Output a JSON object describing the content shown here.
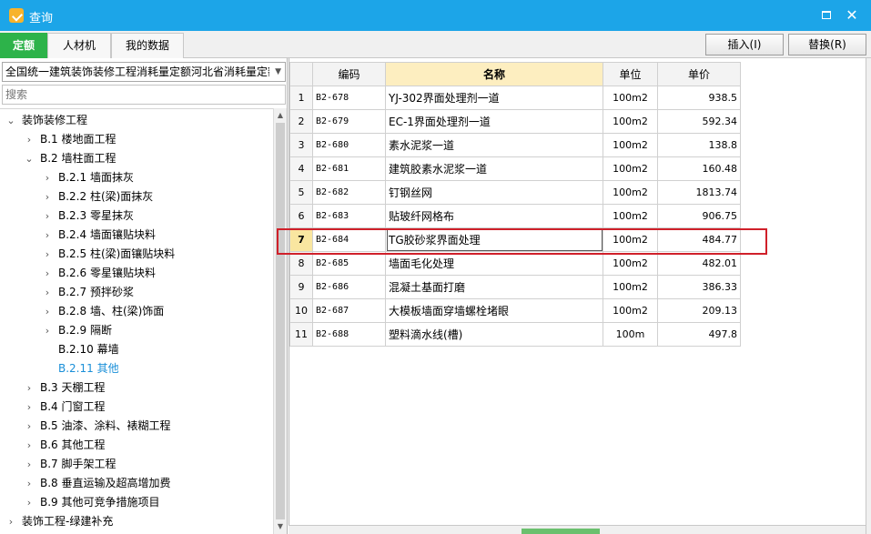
{
  "window": {
    "title": "查询"
  },
  "tabs": [
    {
      "label": "定额",
      "active": true
    },
    {
      "label": "人材机",
      "active": false
    },
    {
      "label": "我的数据",
      "active": false
    }
  ],
  "actions": {
    "insert_label": "插入(I)",
    "replace_label": "替换(R)"
  },
  "library": {
    "selected": "全国统一建筑装饰装修工程消耗量定额河北省消耗量定额"
  },
  "search": {
    "placeholder": "搜索"
  },
  "tree": [
    {
      "label": "装饰装修工程",
      "level": 0,
      "expanded": true
    },
    {
      "label": "B.1 楼地面工程",
      "level": 1,
      "expanded": false
    },
    {
      "label": "B.2 墙柱面工程",
      "level": 1,
      "expanded": true
    },
    {
      "label": "B.2.1 墙面抹灰",
      "level": 2,
      "expanded": false
    },
    {
      "label": "B.2.2 柱(梁)面抹灰",
      "level": 2,
      "expanded": false
    },
    {
      "label": "B.2.3 零星抹灰",
      "level": 2,
      "expanded": false
    },
    {
      "label": "B.2.4 墙面镶贴块料",
      "level": 2,
      "expanded": false
    },
    {
      "label": "B.2.5 柱(梁)面镶贴块料",
      "level": 2,
      "expanded": false
    },
    {
      "label": "B.2.6 零星镶贴块料",
      "level": 2,
      "expanded": false
    },
    {
      "label": "B.2.7 预拌砂浆",
      "level": 2,
      "expanded": false
    },
    {
      "label": "B.2.8 墙、柱(梁)饰面",
      "level": 2,
      "expanded": false
    },
    {
      "label": "B.2.9 隔断",
      "level": 2,
      "expanded": false
    },
    {
      "label": "B.2.10 幕墙",
      "level": 2,
      "leaf": true
    },
    {
      "label": "B.2.11 其他",
      "level": 2,
      "leaf": true,
      "selected": true
    },
    {
      "label": "B.3 天棚工程",
      "level": 1,
      "expanded": false
    },
    {
      "label": "B.4 门窗工程",
      "level": 1,
      "expanded": false
    },
    {
      "label": "B.5 油漆、涂料、裱糊工程",
      "level": 1,
      "expanded": false
    },
    {
      "label": "B.6 其他工程",
      "level": 1,
      "expanded": false
    },
    {
      "label": "B.7 脚手架工程",
      "level": 1,
      "expanded": false
    },
    {
      "label": "B.8 垂直运输及超高增加费",
      "level": 1,
      "expanded": false
    },
    {
      "label": "B.9 其他可竞争措施项目",
      "level": 1,
      "expanded": false
    },
    {
      "label": "装饰工程-绿建补充",
      "level": 0,
      "expanded": false
    }
  ],
  "grid": {
    "headers": {
      "code": "编码",
      "name": "名称",
      "unit": "单位",
      "price": "单价"
    },
    "rows": [
      {
        "idx": "1",
        "code": "B2-678",
        "name": "YJ-302界面处理剂一道",
        "unit": "100m2",
        "price": "938.5"
      },
      {
        "idx": "2",
        "code": "B2-679",
        "name": "EC-1界面处理剂一道",
        "unit": "100m2",
        "price": "592.34"
      },
      {
        "idx": "3",
        "code": "B2-680",
        "name": "素水泥浆一道",
        "unit": "100m2",
        "price": "138.8"
      },
      {
        "idx": "4",
        "code": "B2-681",
        "name": "建筑胶素水泥浆一道",
        "unit": "100m2",
        "price": "160.48"
      },
      {
        "idx": "5",
        "code": "B2-682",
        "name": "钉钢丝网",
        "unit": "100m2",
        "price": "1813.74"
      },
      {
        "idx": "6",
        "code": "B2-683",
        "name": "贴玻纤网格布",
        "unit": "100m2",
        "price": "906.75"
      },
      {
        "idx": "7",
        "code": "B2-684",
        "name": "TG胶砂浆界面处理",
        "unit": "100m2",
        "price": "484.77",
        "selected": true
      },
      {
        "idx": "8",
        "code": "B2-685",
        "name": "墙面毛化处理",
        "unit": "100m2",
        "price": "482.01"
      },
      {
        "idx": "9",
        "code": "B2-686",
        "name": "混凝土基面打磨",
        "unit": "100m2",
        "price": "386.33"
      },
      {
        "idx": "10",
        "code": "B2-687",
        "name": "大模板墙面穿墙螺栓堵眼",
        "unit": "100m2",
        "price": "209.13"
      },
      {
        "idx": "11",
        "code": "B2-688",
        "name": "塑料滴水线(槽)",
        "unit": "100m",
        "price": "497.8"
      }
    ]
  },
  "colors": {
    "titlebar": "#1ca5e8",
    "active_tab": "#2db34a",
    "highlight": "#d0202a",
    "selected_tree": "#1a8fd8"
  }
}
